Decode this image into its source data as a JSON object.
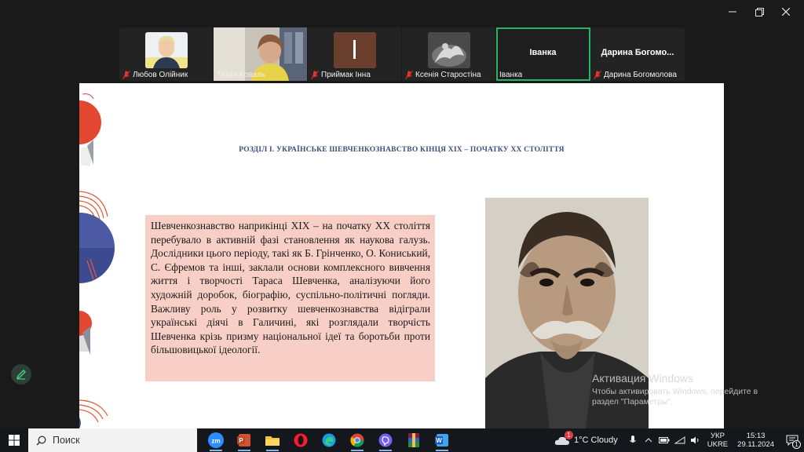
{
  "window": {
    "minimize_icon": "minimize-icon",
    "restore_icon": "restore-icon",
    "close_icon": "close-icon"
  },
  "participants": [
    {
      "name": "Любов Олійник",
      "muted": true
    },
    {
      "name": "Таісія Коваль",
      "muted": false
    },
    {
      "name": "Приймак Інна",
      "muted": true
    },
    {
      "name": "Ксенія Старостіна",
      "muted": true
    },
    {
      "name": "Іванка",
      "display_name": "Іванка",
      "muted": false,
      "active": true
    },
    {
      "name": "Дарина Богомолова",
      "display_name": "Дарина Богомо...",
      "muted": true
    }
  ],
  "slide": {
    "title": "РОЗДІЛ І. УКРАЇНСЬКЕ ШЕВЧЕНКОЗНАВСТВО КІНЦЯ ХІХ – ПОЧАТКУ ХХ СТОЛІТТЯ",
    "body": "Шевченкознавство наприкінці ХІХ – на початку ХХ століття перебувало в активній фазі становлення як наукова галузь. Дослідники цього періоду, такі як Б. Грінченко, О. Кониський, С. Єфремов та інші, заклали основи комплексного вивчення життя і творчості Тараса Шевченка, аналізуючи його художній доробок, біографію, суспільно-політичні погляди. Важливу роль у розвитку шевченкознавства відіграли українські діячі в Галичині, які розглядали творчість Шевченка крізь призму національної ідеї та боротьби проти більшовицької ідеології."
  },
  "activation": {
    "title": "Активация Windows",
    "subtitle": "Чтобы активировать Windows, перейдите в раздел \"Параметры\"."
  },
  "taskbar": {
    "search_placeholder": "Поиск",
    "apps": [
      "zoom-icon",
      "powerpoint-icon",
      "file-explorer-icon",
      "opera-icon",
      "edge-icon",
      "chrome-icon",
      "viber-icon",
      "winrar-icon",
      "word-icon"
    ],
    "weather": {
      "badge": "1",
      "text": "1°C  Cloudy"
    },
    "language": {
      "top": "УКР",
      "bottom": "UKRE"
    },
    "clock": {
      "time": "15:13",
      "date": "29.11.2024"
    },
    "notifications_count": "1"
  },
  "colors": {
    "accent_green": "#27b36a",
    "muted_red": "#e0352b",
    "text_box_bg": "#f8cfc6",
    "title_color": "#3d4e7e"
  }
}
